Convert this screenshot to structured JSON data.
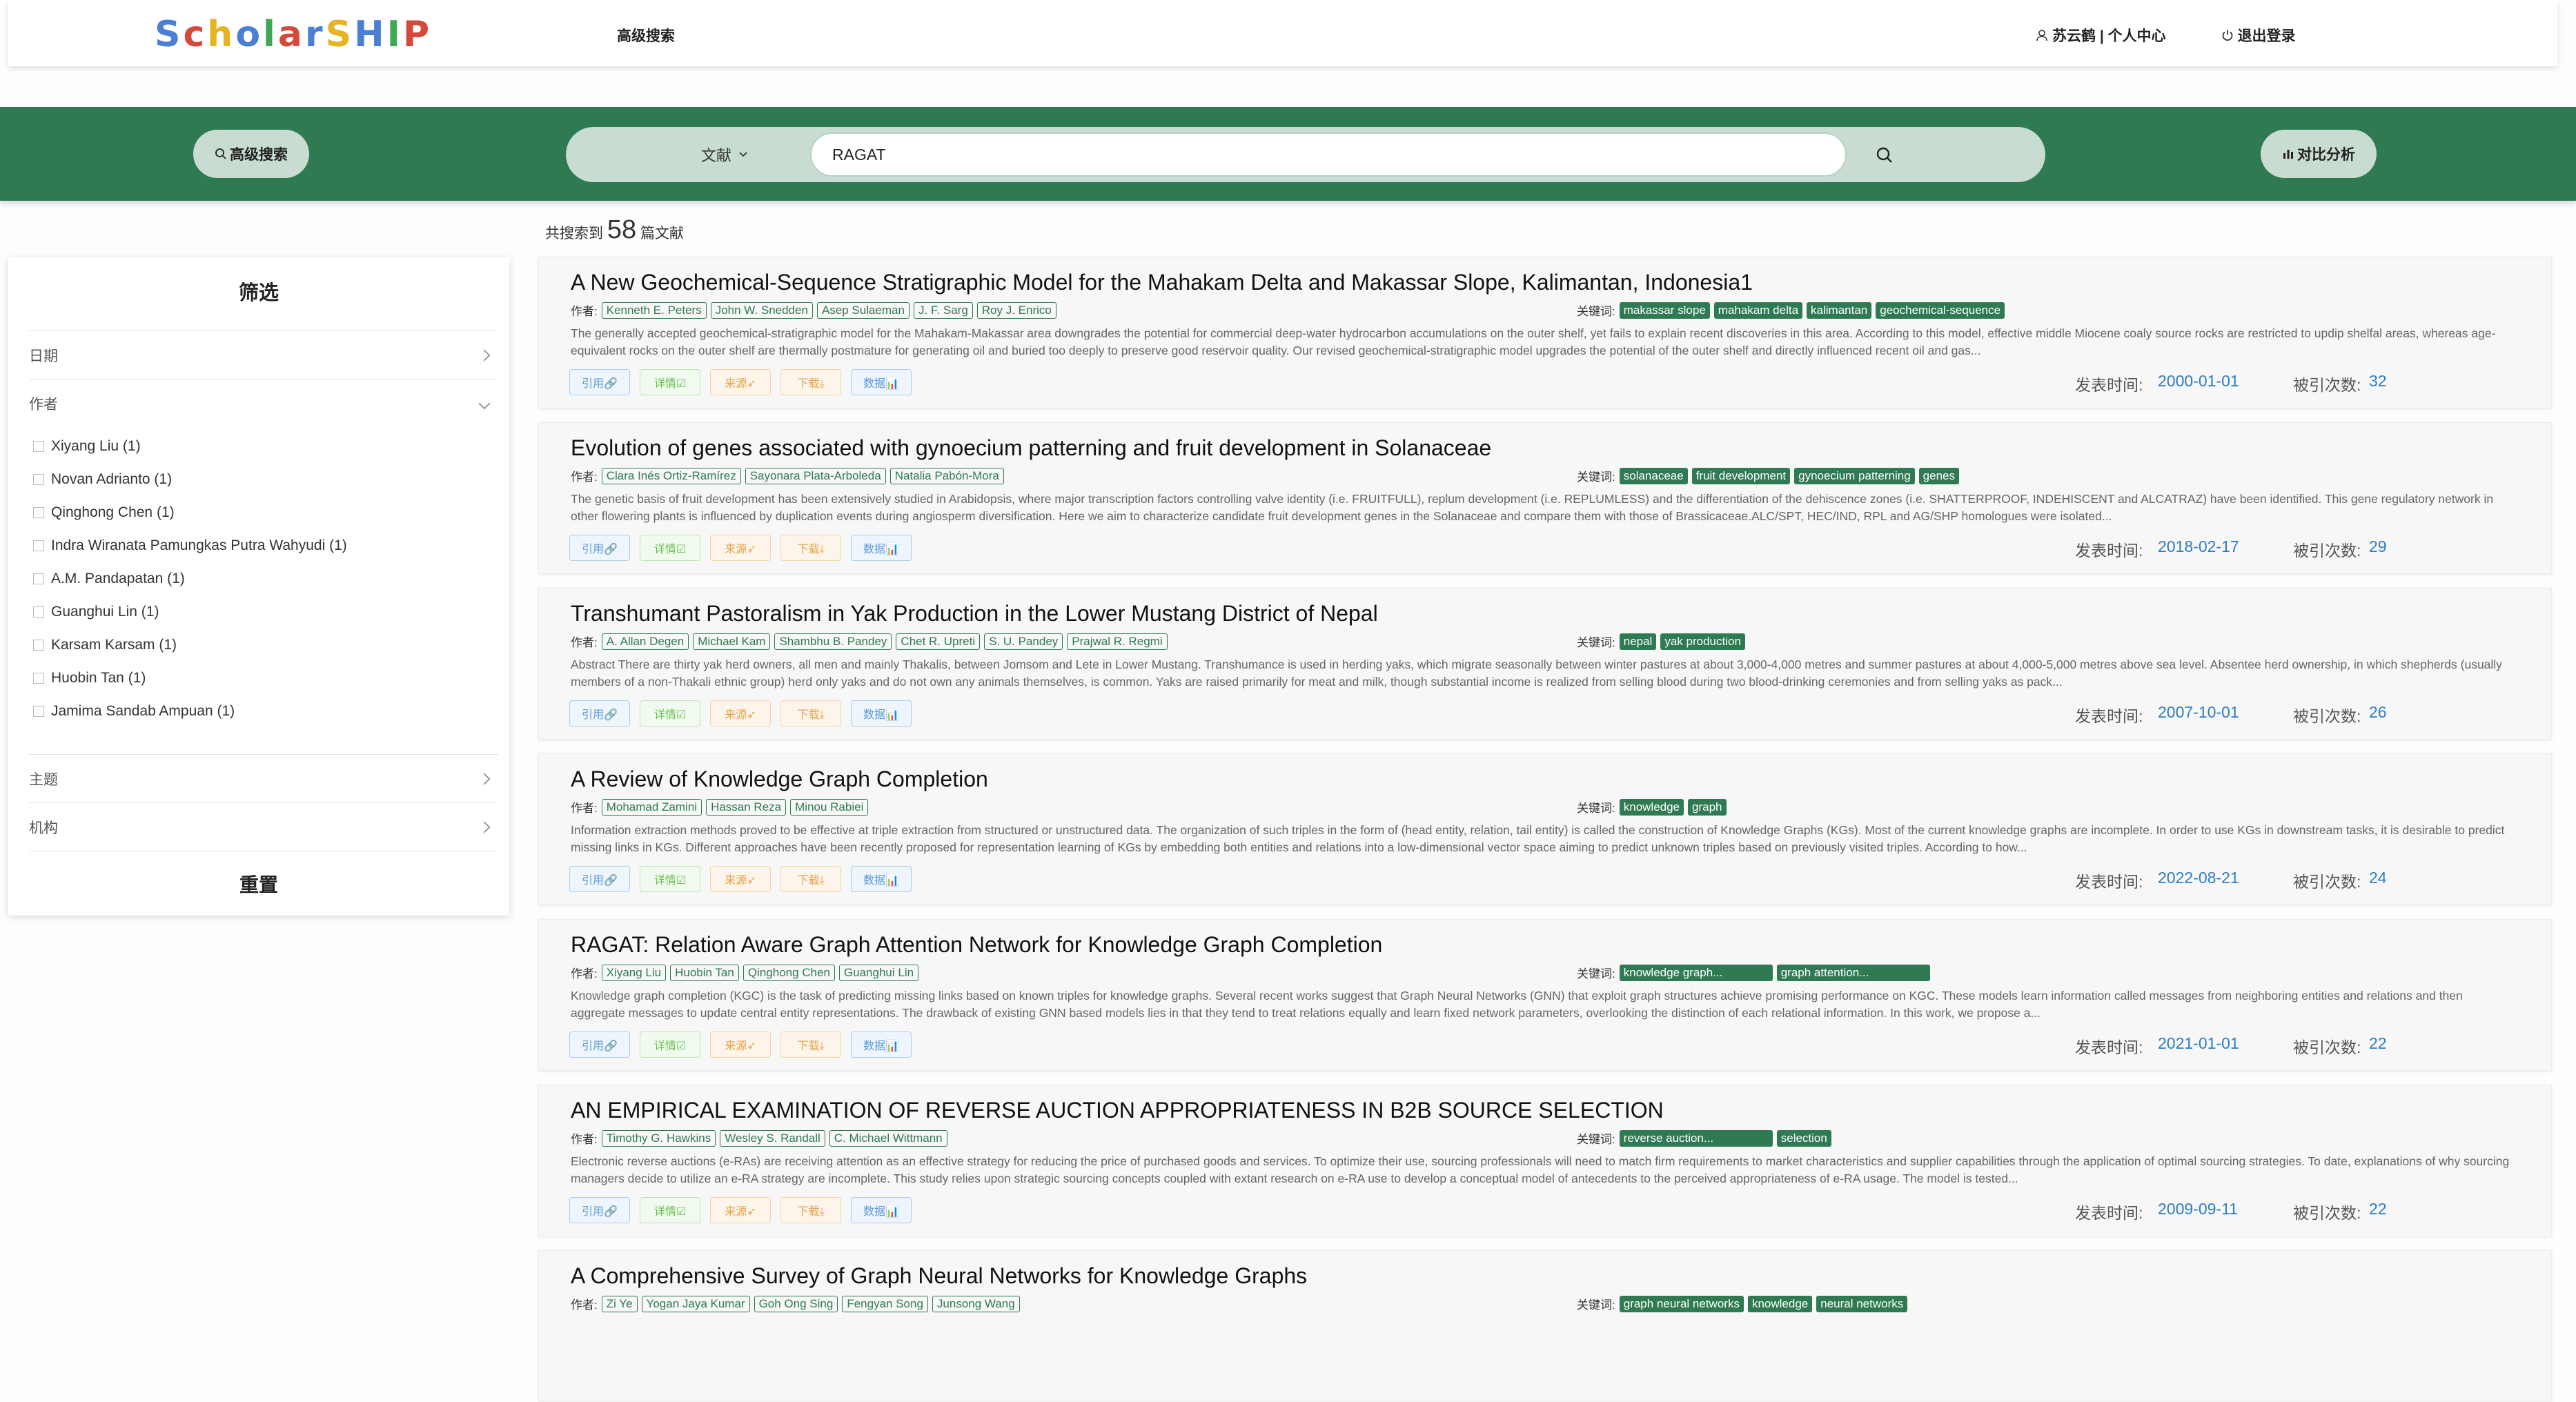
{
  "header": {
    "logo_letters": [
      {
        "ch": "S",
        "color": "#4a7fd4"
      },
      {
        "ch": "c",
        "color": "#d44a3a"
      },
      {
        "ch": "h",
        "color": "#e6b420"
      },
      {
        "ch": "o",
        "color": "#4a7fd4"
      },
      {
        "ch": "l",
        "color": "#3fa855"
      },
      {
        "ch": "a",
        "color": "#d44a3a"
      },
      {
        "ch": "r",
        "color": "#4a7fd4"
      },
      {
        "ch": "S",
        "color": "#e6b420"
      },
      {
        "ch": "H",
        "color": "#4a7fd4"
      },
      {
        "ch": "I",
        "color": "#3fa855"
      },
      {
        "ch": "P",
        "color": "#d44a3a"
      }
    ],
    "nav_advanced": "高级搜索",
    "user_label": "苏云鹤 | 个人中心",
    "logout_label": "退出登录"
  },
  "searchbar": {
    "advanced_label": "高级搜索",
    "type_label": "文献",
    "query": "RAGAT",
    "compare_label": "对比分析"
  },
  "filter": {
    "title": "筛选",
    "date_label": "日期",
    "author_label": "作者",
    "authors": [
      "Xiyang Liu (1)",
      "Novan Adrianto (1)",
      "Qinghong Chen (1)",
      "Indra Wiranata Pamungkas Putra Wahyudi (1)",
      "A.M. Pandapatan (1)",
      "Guanghui Lin (1)",
      "Karsam Karsam (1)",
      "Huobin Tan (1)",
      "Jamima Sandab Ampuan (1)"
    ],
    "topic_label": "主题",
    "org_label": "机构",
    "reset_label": "重置"
  },
  "results": {
    "prefix": "共搜索到",
    "count": "58",
    "suffix": "篇文献",
    "labels": {
      "authors": "作者:",
      "keywords": "关键词:",
      "date": "发表时间:",
      "cited": "被引次数:",
      "cite_btn": "引用🔗",
      "detail_btn": "详情☑",
      "source_btn": "来源➶",
      "download_btn": "下载⤓",
      "data_btn": "数据📊"
    },
    "items": [
      {
        "title": "A New Geochemical-Sequence Stratigraphic Model for the Mahakam Delta and Makassar Slope, Kalimantan, Indonesia1",
        "authors": [
          "Kenneth E. Peters",
          "John W. Snedden",
          "Asep Sulaeman",
          "J. F. Sarg",
          "Roy J. Enrico"
        ],
        "keywords": [
          "makassar slope",
          "mahakam delta",
          "kalimantan",
          "geochemical-sequence"
        ],
        "abstract": "The generally accepted geochemical-stratigraphic model for the Mahakam-Makassar area downgrades the potential for commercial deep-water hydrocarbon accumulations on the outer shelf, yet fails to explain recent discoveries in this area. According to this model, effective middle Miocene coaly source rocks are restricted to updip shelfal areas, whereas age-equivalent rocks on the outer shelf are thermally postmature for generating oil and buried too deeply to preserve good reservoir quality. Our revised geochemical-stratigraphic model upgrades the potential of the outer shelf and directly influenced recent oil and gas...",
        "date": "2000-01-01",
        "cited": "32"
      },
      {
        "title": "Evolution of genes associated with gynoecium patterning and fruit development in Solanaceae",
        "authors": [
          "Clara Inés Ortiz-Ramírez",
          "Sayonara Plata-Arboleda",
          "Natalia Pabón-Mora"
        ],
        "keywords": [
          "solanaceae",
          "fruit development",
          "gynoecium patterning",
          "genes"
        ],
        "abstract": "The genetic basis of fruit development has been extensively studied in Arabidopsis, where major transcription factors controlling valve identity (i.e. FRUITFULL), replum development (i.e. REPLUMLESS) and the differentiation of the dehiscence zones (i.e. SHATTERPROOF, INDEHISCENT and ALCATRAZ) have been identified. This gene regulatory network in other flowering plants is influenced by duplication events during angiosperm diversification. Here we aim to characterize candidate fruit development genes in the Solanaceae and compare them with those of Brassicaceae.ALC/SPT, HEC/IND, RPL and AG/SHP homologues were isolated...",
        "date": "2018-02-17",
        "cited": "29"
      },
      {
        "title": "Transhumant Pastoralism in Yak Production in the Lower Mustang District of Nepal",
        "authors": [
          "A. Allan Degen",
          "Michael Kam",
          "Shambhu B. Pandey",
          "Chet R. Upreti",
          "S. U. Pandey",
          "Prajwal R. Regmi"
        ],
        "keywords": [
          "nepal",
          "yak production"
        ],
        "abstract": "Abstract There are thirty yak herd owners, all men and mainly Thakalis, between Jomsom and Lete in Lower Mustang. Transhumance is used in herding yaks, which migrate seasonally between winter pastures at about 3,000-4,000 metres and summer pastures at about 4,000-5,000 metres above sea level. Absentee herd ownership, in which shepherds (usually members of a non-Thakali ethnic group) herd only yaks and do not own any animals themselves, is common. Yaks are raised primarily for meat and milk, though substantial income is realized from selling blood during two blood-drinking ceremonies and from selling yaks as pack...",
        "date": "2007-10-01",
        "cited": "26"
      },
      {
        "title": "A Review of Knowledge Graph Completion",
        "authors": [
          "Mohamad Zamini",
          "Hassan Reza",
          "Minou Rabiei"
        ],
        "keywords": [
          "knowledge",
          "graph"
        ],
        "abstract": "Information extraction methods proved to be effective at triple extraction from structured or unstructured data. The organization of such triples in the form of (head entity, relation, tail entity) is called the construction of Knowledge Graphs (KGs). Most of the current knowledge graphs are incomplete. In order to use KGs in downstream tasks, it is desirable to predict missing links in KGs. Different approaches have been recently proposed for representation learning of KGs by embedding both entities and relations into a low-dimensional vector space aiming to predict unknown triples based on previously visited triples. According to how...",
        "date": "2022-08-21",
        "cited": "24"
      },
      {
        "title": "RAGAT: Relation Aware Graph Attention Network for Knowledge Graph Completion",
        "authors": [
          "Xiyang Liu",
          "Huobin Tan",
          "Qinghong Chen",
          "Guanghui Lin"
        ],
        "keywords": [
          "knowledge graph...",
          "graph attention..."
        ],
        "abstract": "Knowledge graph completion (KGC) is the task of predicting missing links based on known triples for knowledge graphs. Several recent works suggest that Graph Neural Networks (GNN) that exploit graph structures achieve promising performance on KGC. These models learn information called messages from neighboring entities and relations and then aggregate messages to update central entity representations. The drawback of existing GNN based models lies in that they tend to treat relations equally and learn fixed network parameters, overlooking the distinction of each relational information. In this work, we propose a...",
        "date": "2021-01-01",
        "cited": "22"
      },
      {
        "title": "AN EMPIRICAL EXAMINATION OF REVERSE AUCTION APPROPRIATENESS IN B2B SOURCE SELECTION",
        "authors": [
          "Timothy G. Hawkins",
          "Wesley S. Randall",
          "C. Michael Wittmann"
        ],
        "keywords": [
          "reverse auction...",
          "selection"
        ],
        "abstract": "Electronic reverse auctions (e-RAs) are receiving attention as an effective strategy for reducing the price of purchased goods and services. To optimize their use, sourcing professionals will need to match firm requirements to market characteristics and supplier capabilities through the application of optimal sourcing strategies. To date, explanations of why sourcing managers decide to utilize an e-RA strategy are incomplete. This study relies upon strategic sourcing concepts coupled with extant research on e-RA use to develop a conceptual model of antecedents to the perceived appropriateness of e-RA usage. The model is tested...",
        "date": "2009-09-11",
        "cited": "22"
      },
      {
        "title": "A Comprehensive Survey of Graph Neural Networks for Knowledge Graphs",
        "authors": [
          "Zi Ye",
          "Yogan Jaya Kumar",
          "Goh Ong Sing",
          "Fengyan Song",
          "Junsong Wang"
        ],
        "keywords": [
          "graph neural networks",
          "knowledge",
          "neural networks"
        ],
        "abstract": "",
        "date": "",
        "cited": ""
      }
    ]
  }
}
